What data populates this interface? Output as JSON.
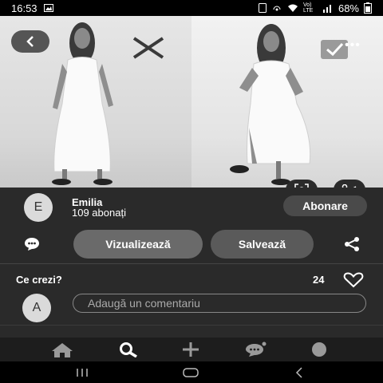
{
  "status_bar": {
    "time": "16:53",
    "network_label": "Vo) LTE",
    "battery": "68%"
  },
  "pin": {
    "creator": {
      "avatar_letter": "E",
      "name": "Emilia",
      "followers": "109 abonați",
      "follow_label": "Abonare"
    },
    "actions": {
      "visit_label": "Vizualizează",
      "save_label": "Salvează"
    },
    "comments": {
      "title": "Ce crezi?",
      "likes": "24",
      "user_avatar_letter": "A",
      "input_placeholder": "Adaugă un comentariu"
    }
  },
  "icons": {
    "back": "chevron-left-icon",
    "reject": "x-icon",
    "accept": "checkbox-check-icon",
    "more": "more-dots-icon",
    "lens": "visual-search-icon",
    "scissors": "scissors-icon",
    "comment": "speech-bubble-icon",
    "share": "share-icon",
    "heart": "heart-icon",
    "nav": [
      "home-icon",
      "search-icon",
      "plus-icon",
      "chat-icon",
      "profile-icon"
    ]
  },
  "colors": {
    "panel_bg": "#2a2a2a",
    "visit_button": "#6a6a6a",
    "save_button": "#5a5a5a",
    "follow_button": "#4a4a4a"
  }
}
